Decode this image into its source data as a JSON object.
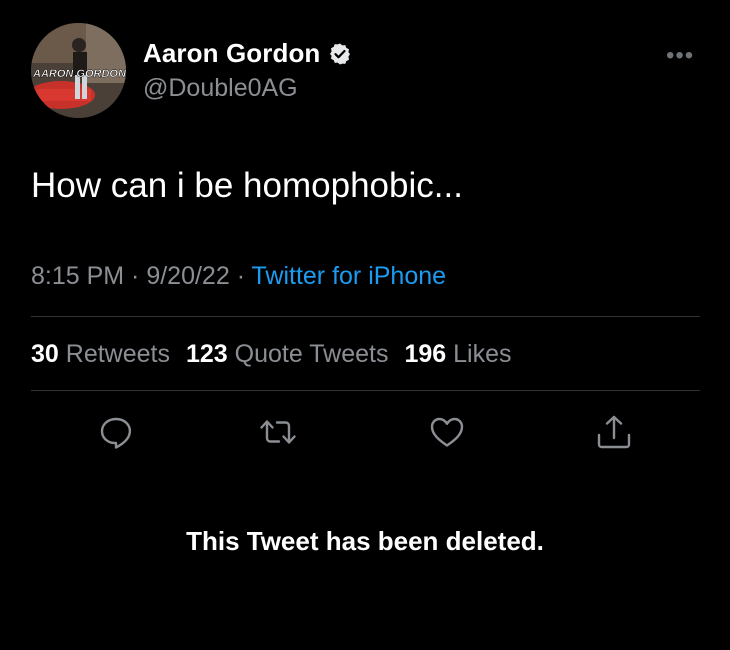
{
  "author": {
    "name": "Aaron Gordon",
    "handle": "@Double0AG",
    "avatar_text": "AARON GORDON"
  },
  "tweet": {
    "text": "How can i be homophobic...",
    "time": "8:15 PM",
    "date": "9/20/22",
    "separator": " · ",
    "source": "Twitter for iPhone"
  },
  "stats": [
    {
      "value": "30",
      "label": "Retweets"
    },
    {
      "value": "123",
      "label": "Quote Tweets"
    },
    {
      "value": "196",
      "label": "Likes"
    }
  ],
  "more_menu": "•••",
  "actions": [
    "reply-icon",
    "retweet-icon",
    "like-icon",
    "share-icon"
  ],
  "deleted_notice": "This Tweet has been deleted.",
  "colors": {
    "background": "#000000",
    "link": "#1d9bf0",
    "secondary_text": "#8b8f94",
    "divider": "#2f3336"
  }
}
